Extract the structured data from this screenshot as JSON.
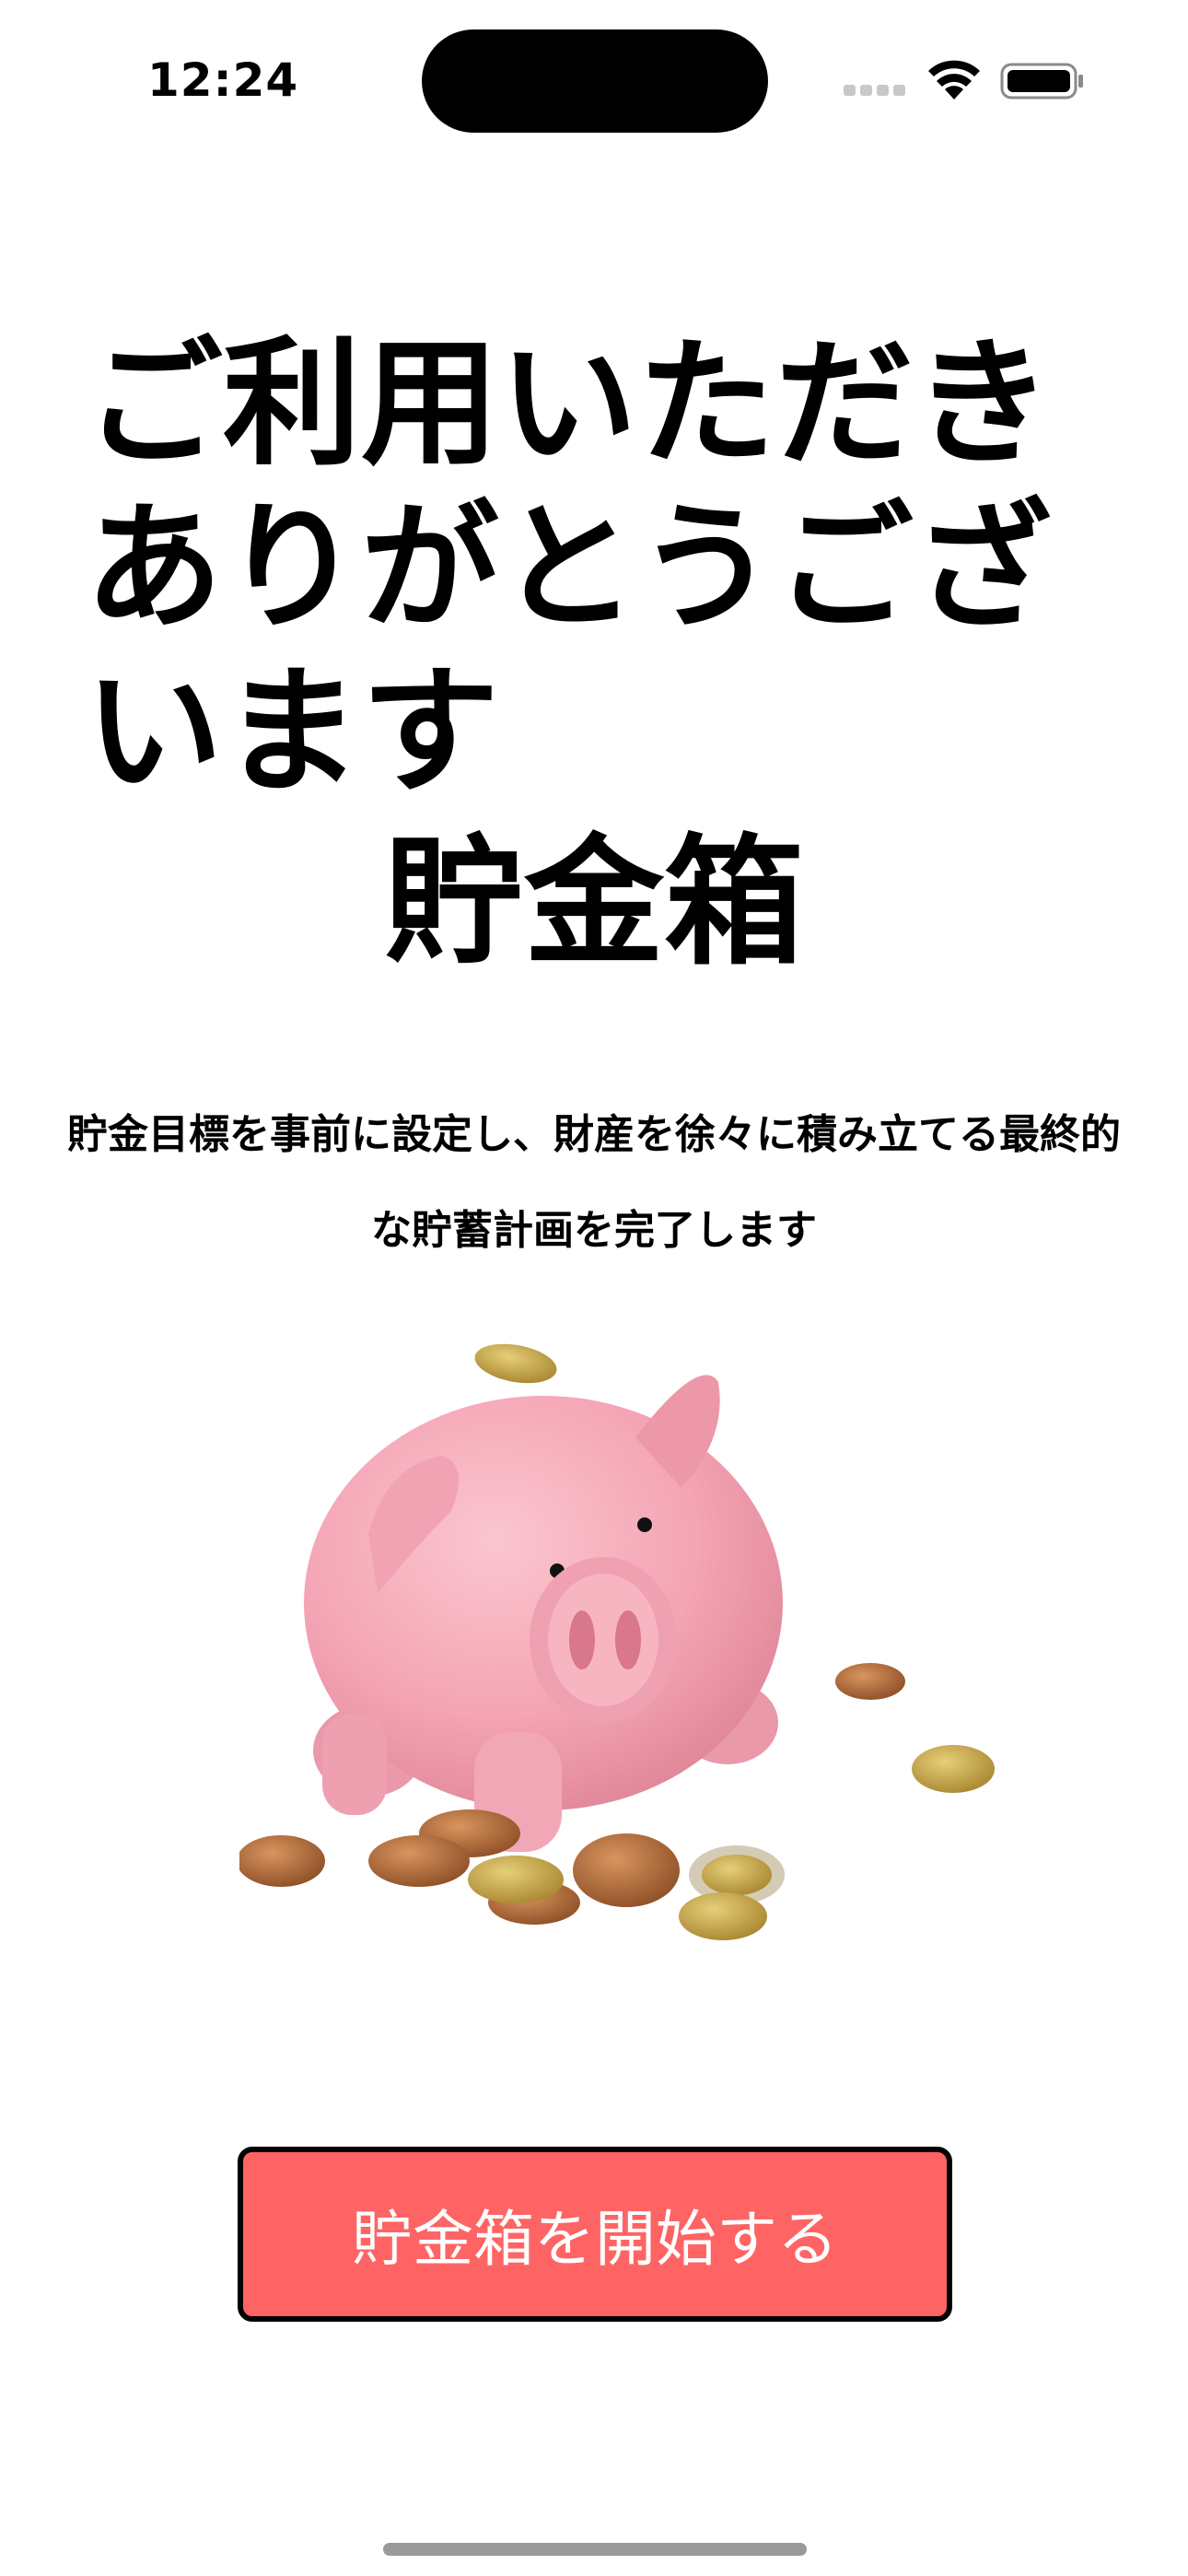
{
  "status_bar": {
    "time": "12:24",
    "icons": [
      "cellular-signal-icon",
      "wifi-icon",
      "battery-icon"
    ]
  },
  "welcome": {
    "title": "ご利用いただきありがとうございます",
    "app_name": "貯金箱",
    "description": "貯金目標を事前に設定し、財産を徐々に積み立てる最終的な貯蓄計画を完了します"
  },
  "illustration": {
    "name": "piggy-bank-with-coins"
  },
  "actions": {
    "start_button_label": "貯金箱を開始する"
  },
  "colors": {
    "accent": "#ff6465",
    "button_border": "#000000",
    "button_text": "#ffffff",
    "piggy_pink": "#f4a4b4",
    "coin_copper": "#b06a3a",
    "coin_gold": "#c9a64a"
  }
}
